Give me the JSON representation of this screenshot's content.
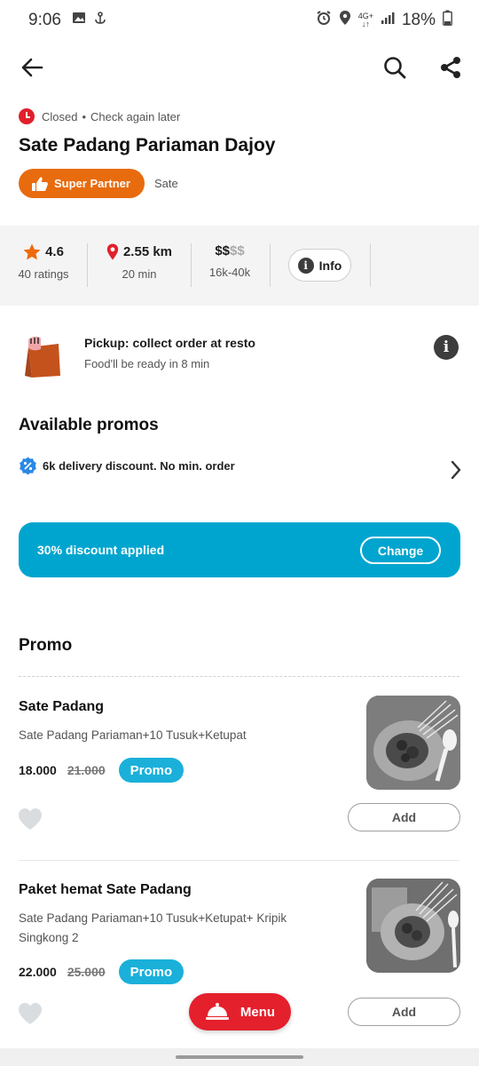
{
  "status_bar": {
    "time": "9:06",
    "network": "4G+",
    "battery": "18%"
  },
  "store": {
    "open_status": "Closed",
    "status_note": "Check again later",
    "name": "Sate Padang Pariaman Dajoy",
    "badge": "Super Partner",
    "cuisine": "Sate"
  },
  "stats": {
    "rating": "4.6",
    "ratings_count": "40 ratings",
    "distance": "2.55 km",
    "time": "20 min",
    "price_level_active": "$$",
    "price_level_inactive": "$$",
    "price_range": "16k-40k",
    "info_label": "Info"
  },
  "pickup": {
    "title": "Pickup: collect order at resto",
    "subtitle": "Food'll be ready in 8 min"
  },
  "promos": {
    "heading": "Available promos",
    "offer": "6k delivery discount. No min. order",
    "discount_applied": "30% discount applied",
    "change_label": "Change"
  },
  "section": {
    "heading": "Promo"
  },
  "items": [
    {
      "name": "Sate Padang",
      "description": "Sate Padang Pariaman+10 Tusuk+Ketupat",
      "price": "18.000",
      "old_price": "21.000",
      "tag": "Promo",
      "add_label": "Add"
    },
    {
      "name": "Paket hemat Sate Padang",
      "description": "Sate Padang Pariaman+10 Tusuk+Ketupat+ Kripik Singkong 2",
      "price": "22.000",
      "old_price": "25.000",
      "tag": "Promo",
      "add_label": "Add"
    }
  ],
  "menu_button": {
    "label": "Menu"
  },
  "colors": {
    "accent_orange": "#e86b0e",
    "promo_blue": "#00a5cf",
    "menu_red": "#e4202c"
  }
}
